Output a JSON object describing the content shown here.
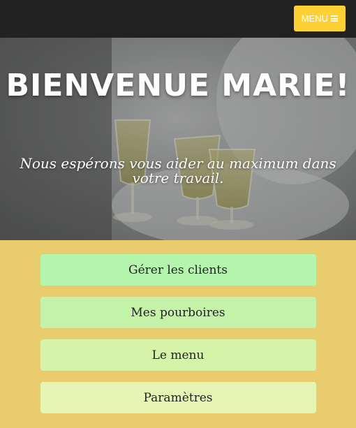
{
  "navbar": {
    "menu_label": "MENU",
    "menu_icon": "bars-icon",
    "menu_color": "#fdd134"
  },
  "hero": {
    "title": "BIENVENUE MARIE!",
    "subtitle": "Nous espérons vous aider au maximum dans votre travail."
  },
  "actions": [
    {
      "label": "Gérer les clients",
      "color": "#b4f4ad"
    },
    {
      "label": "Mes pourboires",
      "color": "#c5f2a9"
    },
    {
      "label": "Le menu",
      "color": "#d6f4a9"
    },
    {
      "label": "Paramètres",
      "color": "#e6f5b3"
    }
  ],
  "page_background": "#e8cc6e"
}
